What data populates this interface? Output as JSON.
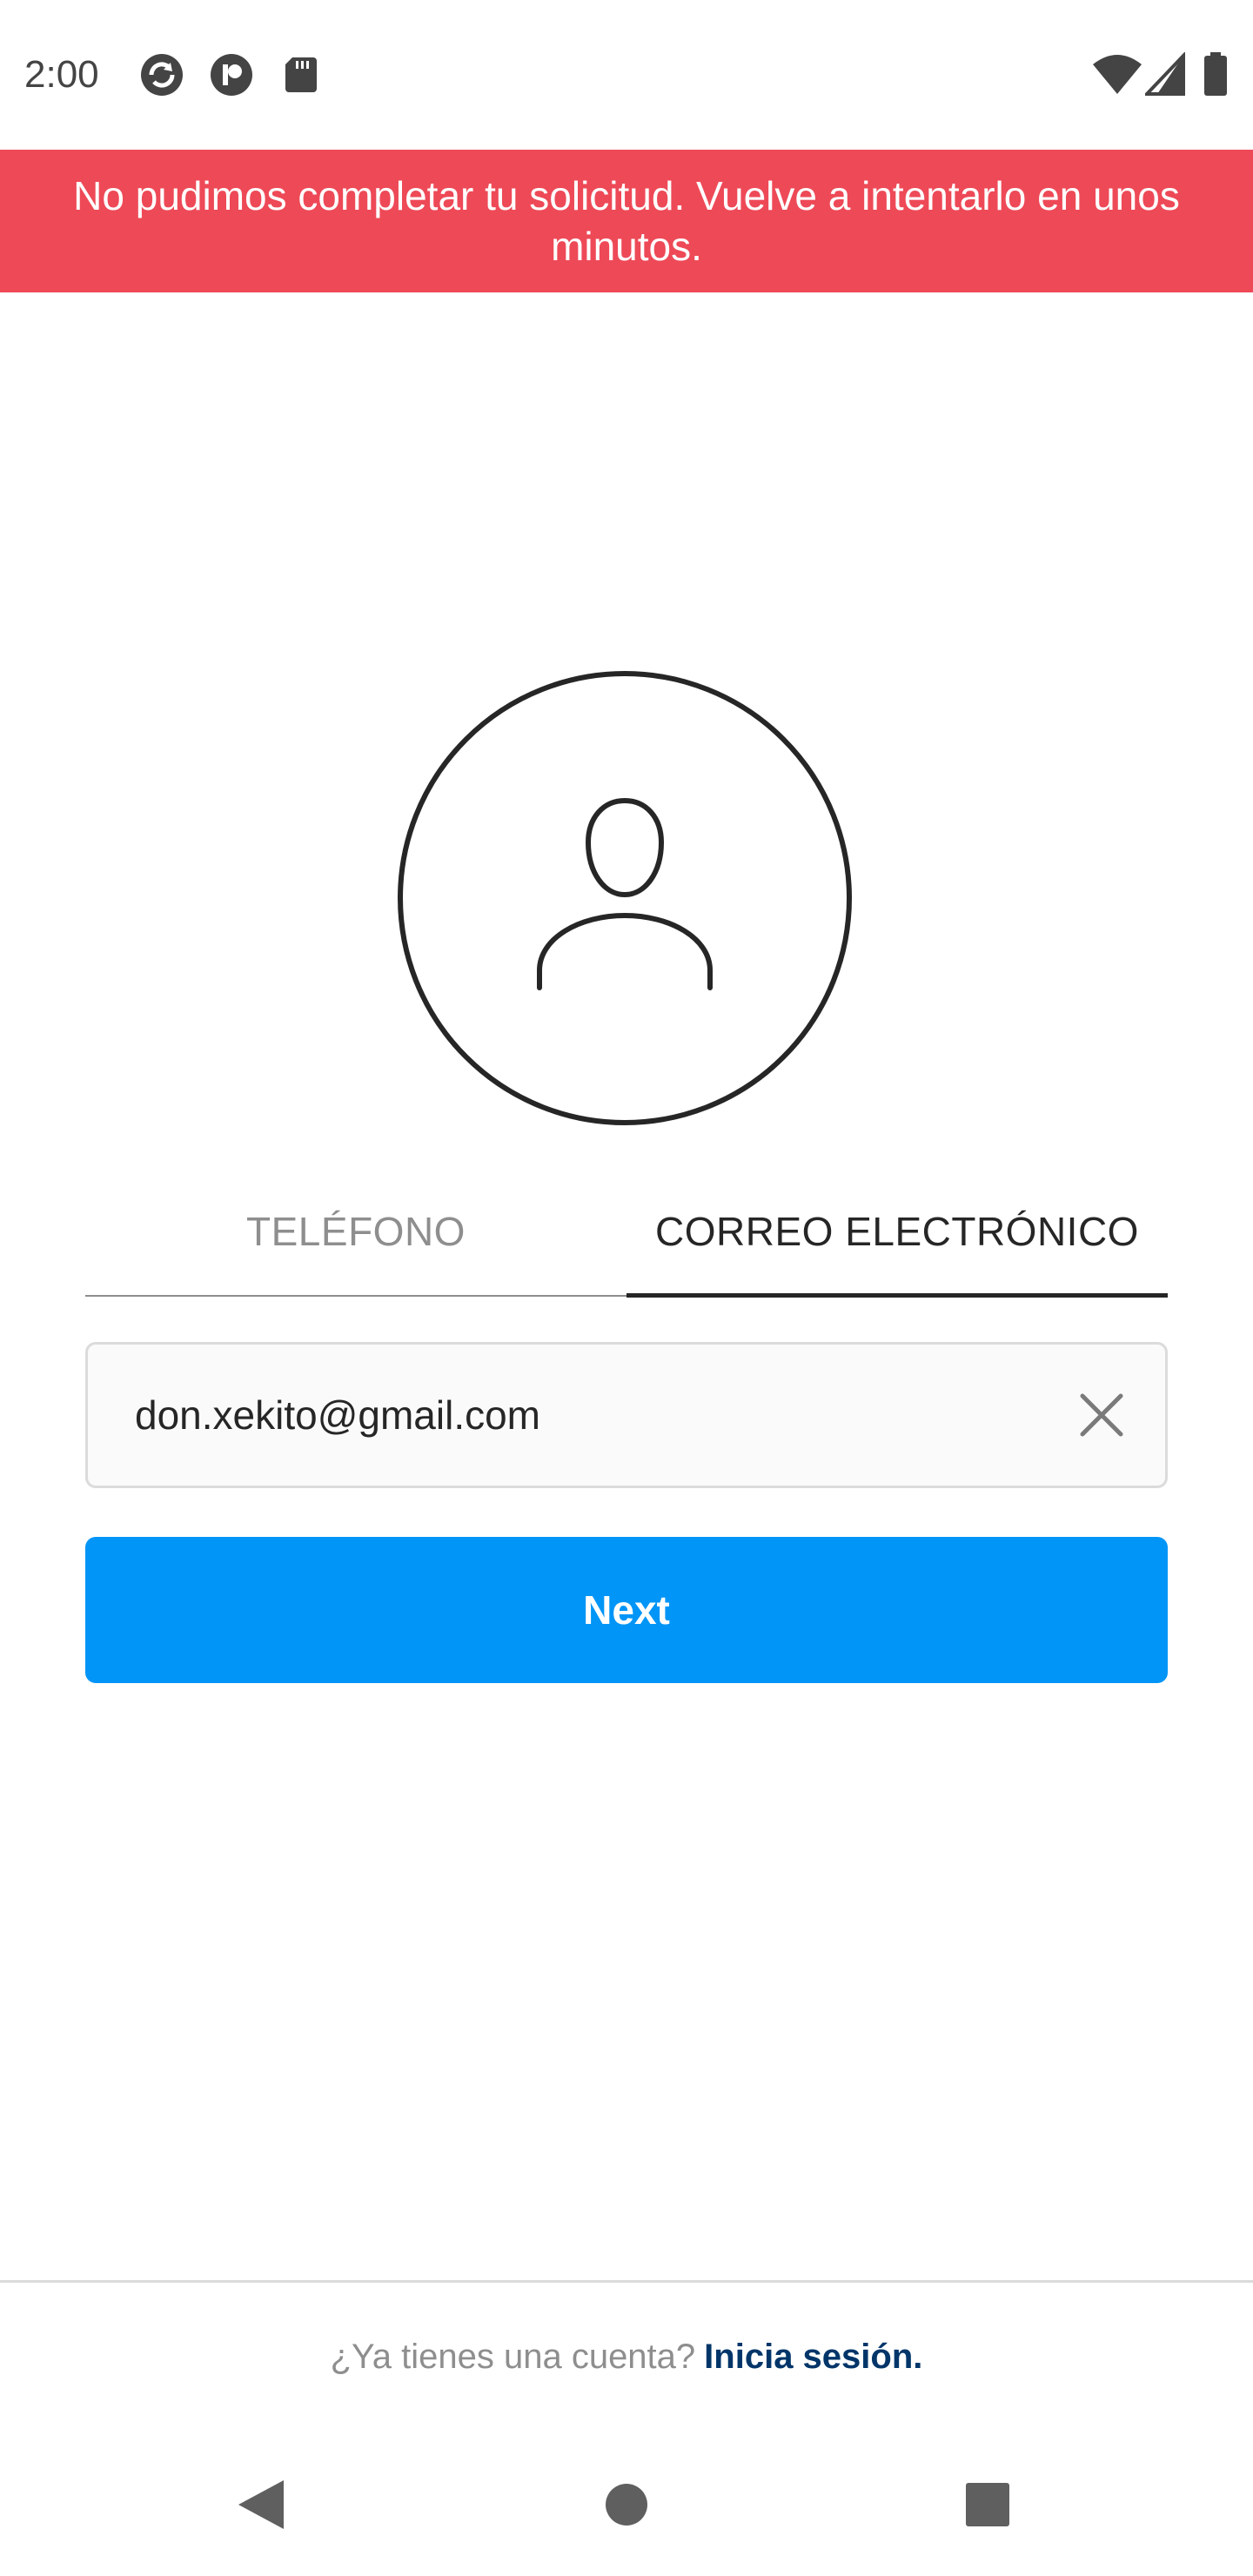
{
  "status_bar": {
    "time": "2:00",
    "left_icons": [
      "sync-icon",
      "app-badge-icon",
      "sd-card-icon"
    ],
    "right_icons": [
      "wifi-icon",
      "cell-signal-icon",
      "battery-icon"
    ]
  },
  "error_banner": {
    "message": "No pudimos completar tu solicitud. Vuelve a intentarlo en unos minutos."
  },
  "avatar": {
    "icon": "user-avatar-icon"
  },
  "tabs": [
    {
      "label": "TELÉFONO",
      "selected": false
    },
    {
      "label": "CORREO ELECTRÓNICO",
      "selected": true
    }
  ],
  "email_field": {
    "value": "don.xekito@gmail.com",
    "clear_icon": "close-icon"
  },
  "next_button": {
    "label": "Next"
  },
  "footer": {
    "prompt": "¿Ya tienes una cuenta?",
    "link": "Inicia sesión."
  },
  "nav_bar": {
    "icons": [
      "back-icon",
      "home-icon",
      "recents-icon"
    ]
  },
  "colors": {
    "banner": "#ED4956",
    "primary_button": "#0095F6",
    "link": "#003569",
    "text_primary": "#262626",
    "text_secondary": "#8e8e8e"
  }
}
